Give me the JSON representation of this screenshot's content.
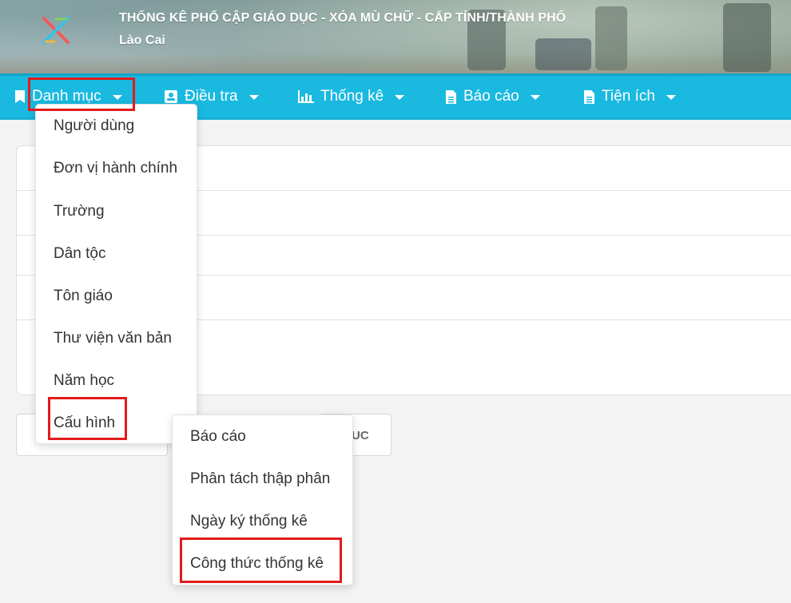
{
  "header": {
    "title": "THỐNG KÊ PHỔ CẬP GIÁO DỤC - XÓA MÙ CHỮ - CẤP TỈNH/THÀNH PHỐ",
    "subtitle": "Lào Cai",
    "logo_icon": "colorful-x-logo-icon"
  },
  "nav": {
    "items": [
      {
        "label": "Danh mục",
        "icon": "bookmark-icon"
      },
      {
        "label": "Điều tra",
        "icon": "contact-card-icon"
      },
      {
        "label": "Thống kê",
        "icon": "bar-chart-icon"
      },
      {
        "label": "Báo cáo",
        "icon": "document-icon"
      },
      {
        "label": "Tiện ích",
        "icon": "document-icon"
      }
    ]
  },
  "danh_muc_menu": {
    "items": [
      {
        "label": "Người dùng"
      },
      {
        "label": "Đơn vị hành chính"
      },
      {
        "label": "Trường"
      },
      {
        "label": "Dân tộc"
      },
      {
        "label": "Tôn giáo"
      },
      {
        "label": "Thư viện văn bản"
      },
      {
        "label": "Năm học"
      },
      {
        "label": "Cấu hình"
      }
    ]
  },
  "cau_hinh_submenu": {
    "items": [
      {
        "label": "Báo cáo"
      },
      {
        "label": "Phân tách thập phân"
      },
      {
        "label": "Ngày ký thống kê"
      },
      {
        "label": "Công thức thống kê"
      }
    ]
  },
  "background": {
    "partial_button_text": "UC"
  },
  "colors": {
    "navbar": "#19b9e0",
    "highlight": "#e31b1b",
    "header_text": "#ffffff"
  }
}
